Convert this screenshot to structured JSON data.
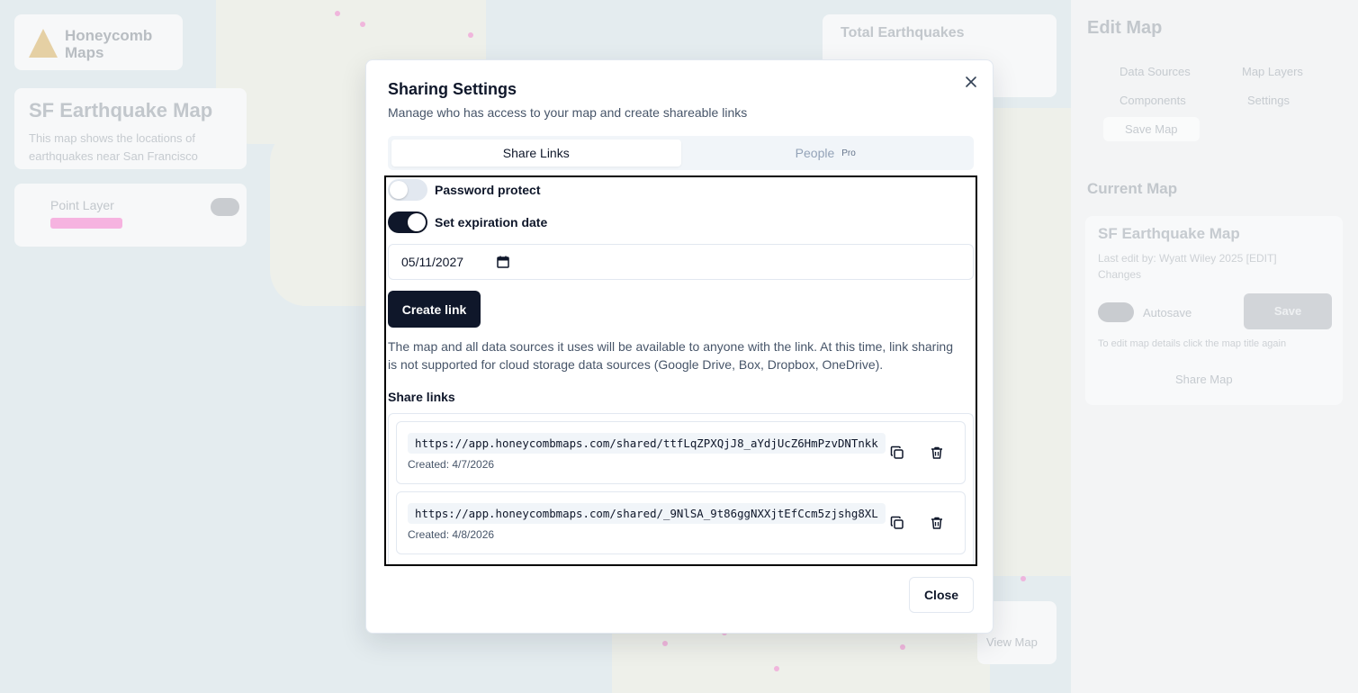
{
  "background": {
    "brand": "Honeycomb Maps",
    "map_title": "SF Earthquake Map",
    "map_description": "This map shows the locations of earthquakes near San Francisco",
    "layer_name": "Point Layer",
    "stats_title": "Total Earthquakes",
    "view_map": "View Map",
    "right_panel": {
      "title": "Edit Map",
      "tabs": [
        "Data Sources",
        "Map Layers",
        "Components",
        "Settings",
        "Save Map"
      ],
      "current_map_heading": "Current Map",
      "card_title": "SF Earthquake Map",
      "card_desc": "Last edit by: Wyatt Wiley 2025 [EDIT] Changes",
      "toggle_label": "Autosave",
      "save_label": "Save",
      "note": "To edit map details click the map title again",
      "share_label": "Share Map"
    }
  },
  "dialog": {
    "title": "Sharing Settings",
    "description": "Manage who has access to your map and create shareable links",
    "tabs": [
      {
        "label": "Share Links",
        "active": true
      },
      {
        "label": "People",
        "badge": "Pro",
        "active": false
      }
    ],
    "password_protect": {
      "label": "Password protect",
      "on": false
    },
    "expiration": {
      "label": "Set expiration date",
      "on": true
    },
    "date_value": "05/11/2027",
    "create_button": "Create link",
    "info": "The map and all data sources it uses will be available to anyone with the link. At this time, link sharing is not supported for cloud storage data sources (Google Drive, Box, Dropbox, OneDrive).",
    "share_links_heading": "Share links",
    "links": [
      {
        "url": "https://app.honeycombmaps.com/shared/ttfLqZPXQjJ8_aYdjUcZ6HmPzvDNTnkk",
        "created": "Created: 4/7/2026"
      },
      {
        "url": "https://app.honeycombmaps.com/shared/_9NlSA_9t86ggNXXjtEfCcm5zjshg8XL",
        "created": "Created: 4/8/2026"
      }
    ],
    "close_button": "Close"
  },
  "colors": {
    "primary": "#0f172a",
    "muted_text": "#475569",
    "border": "#e2e8f0",
    "tab_bg": "#f1f5f9"
  }
}
